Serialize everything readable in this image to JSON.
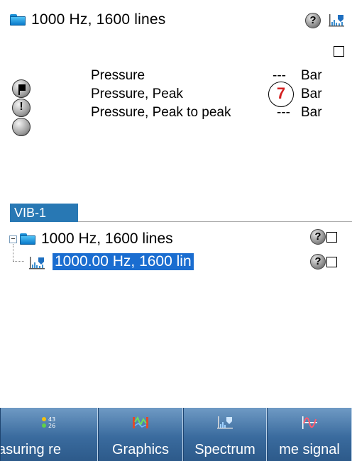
{
  "top": {
    "title": "1000 Hz, 1600 lines",
    "help_icon_label": "?"
  },
  "status_icons": [
    "flag-icon",
    "exclamation-icon",
    "empty-circle-icon"
  ],
  "status_glyphs": {
    "alert": "!"
  },
  "measurements": [
    {
      "name": "Pressure",
      "value": "---",
      "unit": "Bar"
    },
    {
      "name": "Pressure, Peak",
      "value": "-",
      "unit": "Bar"
    },
    {
      "name": "Pressure, Peak to peak",
      "value": "---",
      "unit": "Bar"
    }
  ],
  "marker_label": "7",
  "section": {
    "label": "VIB-1"
  },
  "tree": {
    "expander": "−",
    "root": {
      "label": "1000 Hz, 1600 lines",
      "help": "?"
    },
    "child": {
      "label": "1000.00 Hz, 1600 lin",
      "help": "?"
    }
  },
  "toolbar": {
    "buttons": [
      {
        "label": "asuring re",
        "icon": "measuring-results-icon"
      },
      {
        "label": "Graphics",
        "icon": "graphics-icon"
      },
      {
        "label": "Spectrum",
        "icon": "spectrum-icon"
      },
      {
        "label": "me signal",
        "icon": "time-signal-icon"
      }
    ]
  },
  "colors": {
    "accent": "#2878b4",
    "selection": "#1a6dd0",
    "toolbar": "#3a6b9e",
    "marker": "#d42020"
  }
}
